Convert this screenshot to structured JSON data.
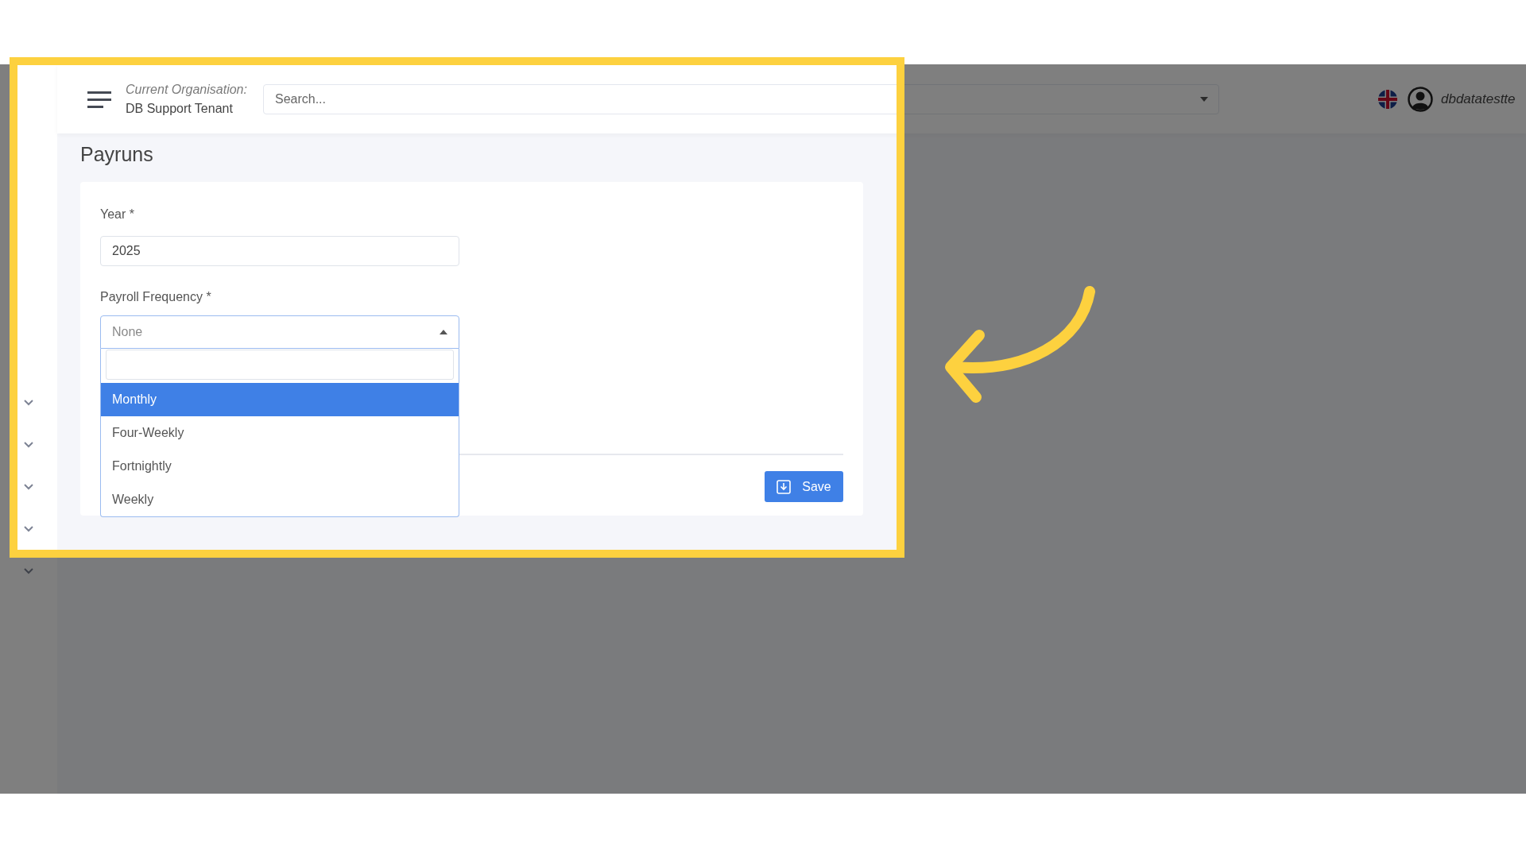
{
  "header": {
    "organisation_label": "Current Organisation:",
    "organisation_name": "DB Support Tenant",
    "search": {
      "placeholder": "Search..."
    },
    "username": "dbdatatestte"
  },
  "page": {
    "title": "Payruns"
  },
  "form": {
    "year": {
      "label": "Year *",
      "value": "2025"
    },
    "payroll_frequency": {
      "label": "Payroll Frequency *",
      "placeholder": "None",
      "expanded": true,
      "options": [
        {
          "label": "Monthly",
          "selected": true
        },
        {
          "label": "Four-Weekly",
          "selected": false
        },
        {
          "label": "Fortnightly",
          "selected": false
        },
        {
          "label": "Weekly",
          "selected": false
        }
      ]
    }
  },
  "save_button": "Save"
}
